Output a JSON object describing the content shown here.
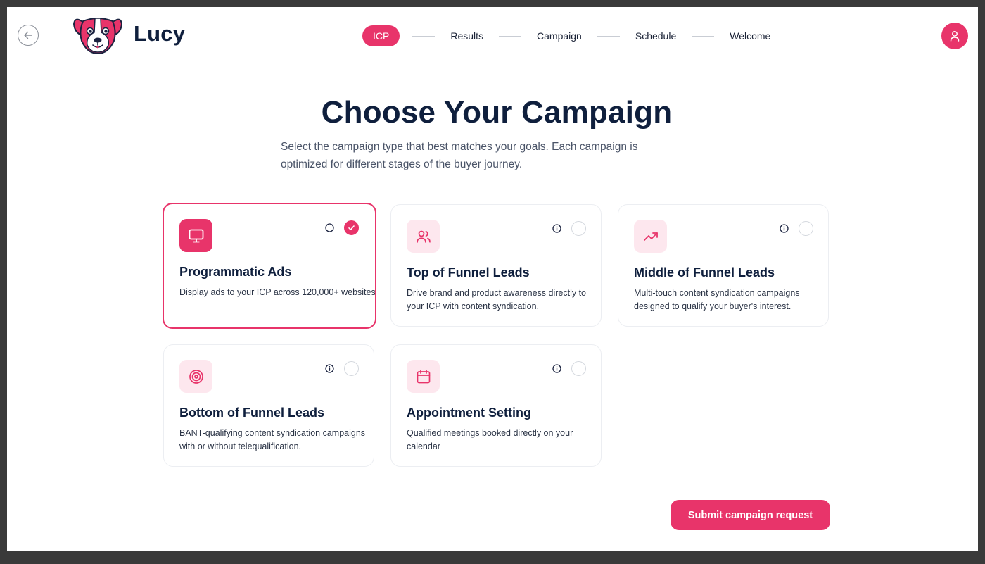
{
  "header": {
    "brand": "Lucy",
    "steps": [
      {
        "label": "ICP",
        "active": true
      },
      {
        "label": "Results",
        "active": false
      },
      {
        "label": "Campaign",
        "active": false
      },
      {
        "label": "Schedule",
        "active": false
      },
      {
        "label": "Welcome",
        "active": false
      }
    ]
  },
  "main": {
    "title": "Choose Your Campaign",
    "subtitle": "Select the campaign type that best matches your goals. Each campaign is optimized for different stages of the buyer journey."
  },
  "cards": [
    {
      "title": "Programmatic Ads",
      "description": "Display ads to your ICP across 120,000+ websites",
      "icon": "monitor-icon",
      "selected": true
    },
    {
      "title": "Top of Funnel Leads",
      "description": "Drive brand and product awareness directly to your ICP with content syndication.",
      "icon": "users-icon",
      "selected": false
    },
    {
      "title": "Middle of Funnel Leads",
      "description": "Multi-touch content syndication campaigns designed to qualify your buyer's interest.",
      "icon": "trending-up-icon",
      "selected": false
    },
    {
      "title": "Bottom of Funnel Leads",
      "description": "BANT-qualifying content syndication campaigns with or without telequalification.",
      "icon": "target-icon",
      "selected": false
    },
    {
      "title": "Appointment Setting",
      "description": "Qualified meetings booked directly on your calendar",
      "icon": "calendar-icon",
      "selected": false
    }
  ],
  "actions": {
    "submit_label": "Submit campaign request"
  },
  "colors": {
    "accent": "#e8346a",
    "accent_soft": "#fde7ee",
    "heading": "#0f1f3d"
  }
}
